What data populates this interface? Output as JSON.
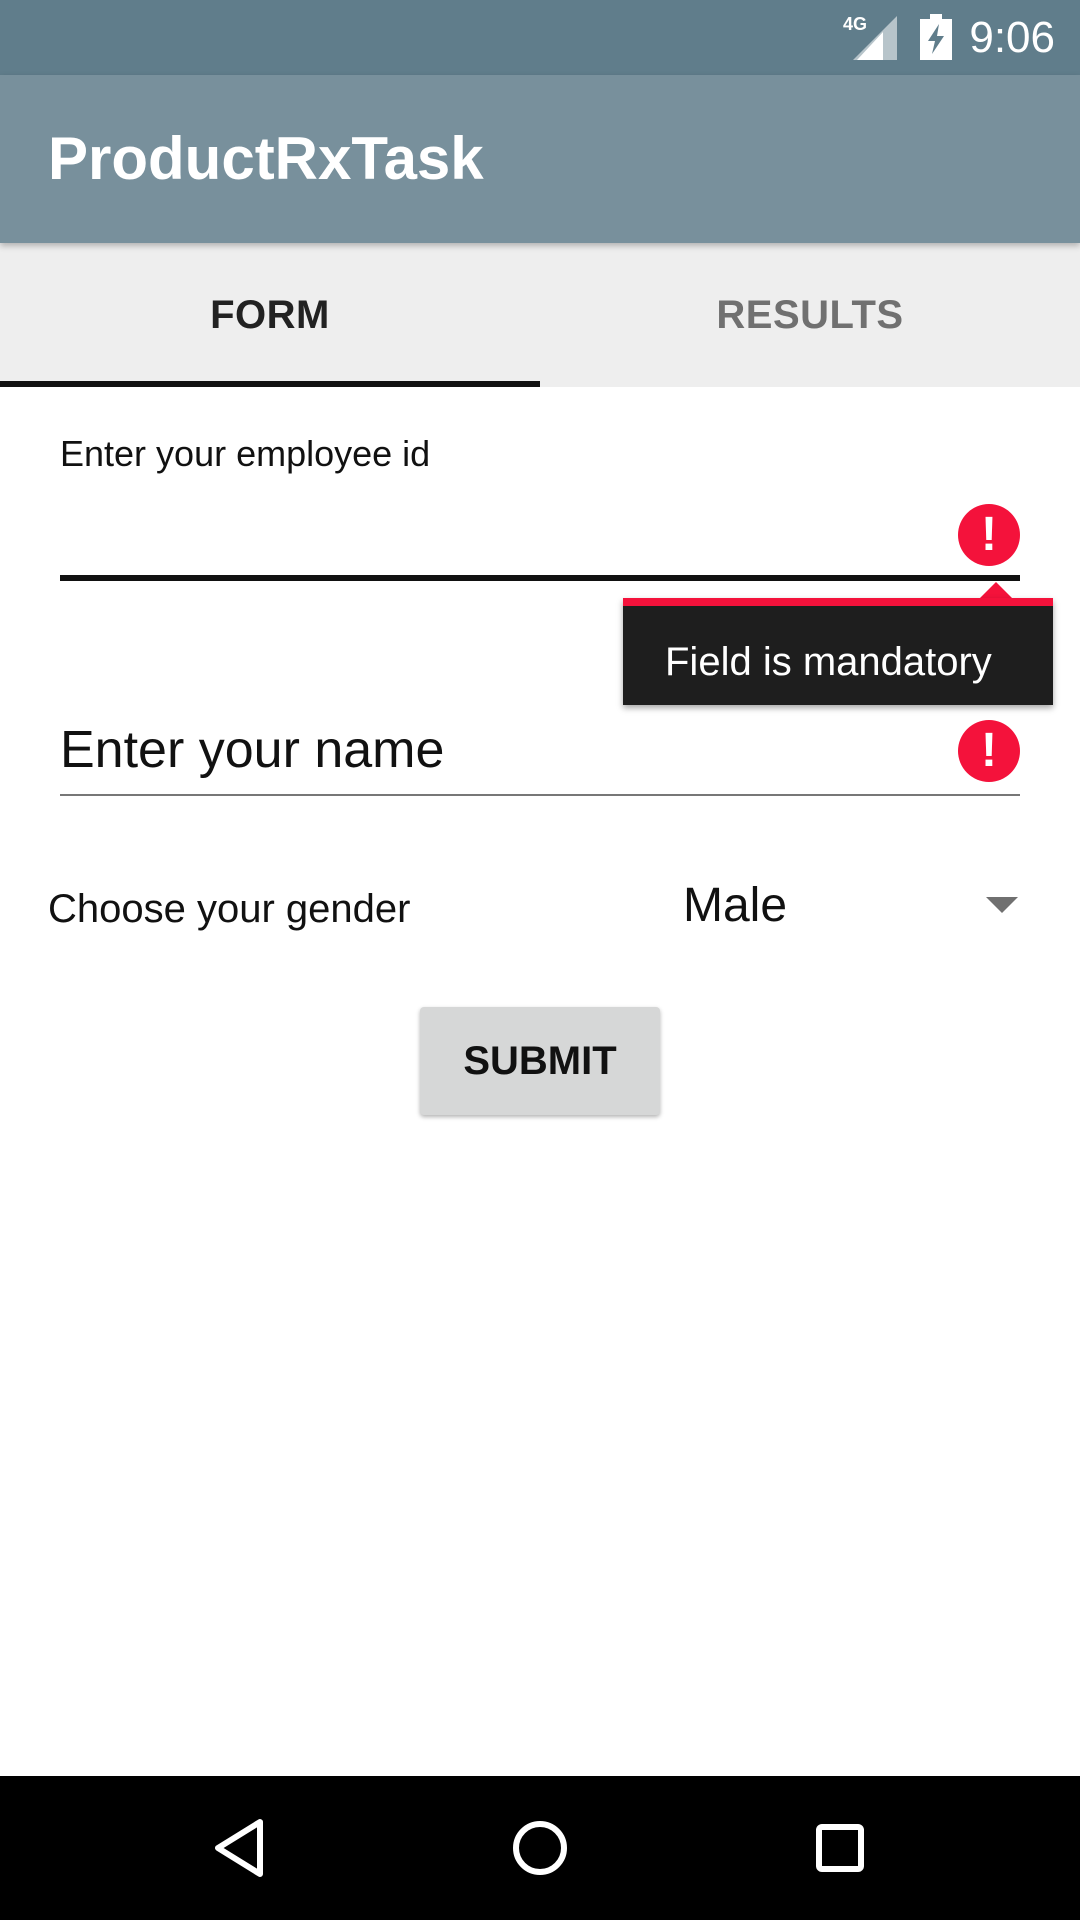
{
  "status_bar": {
    "network": "4G",
    "time": "9:06",
    "icons": [
      "signal-icon",
      "battery-charging-icon"
    ]
  },
  "app_bar": {
    "title": "ProductRxTask"
  },
  "tabs": [
    {
      "label": "FORM",
      "selected": true
    },
    {
      "label": "RESULTS",
      "selected": false
    }
  ],
  "form": {
    "employee_id": {
      "label": "Enter your employee id",
      "value": "",
      "error_icon": "error-icon",
      "error_message": "Field is mandatory"
    },
    "name": {
      "placeholder": "Enter your name",
      "value": "",
      "error_icon": "error-icon"
    },
    "gender": {
      "label": "Choose your gender",
      "selected": "Male"
    },
    "submit_label": "SUBMIT"
  },
  "colors": {
    "status_bar": "#607d8b",
    "app_bar": "#78909c",
    "error": "#f4123b",
    "tabs_bg": "#eeeeee"
  },
  "nav_bar": {
    "buttons": [
      "back-icon",
      "home-icon",
      "recents-icon"
    ]
  }
}
